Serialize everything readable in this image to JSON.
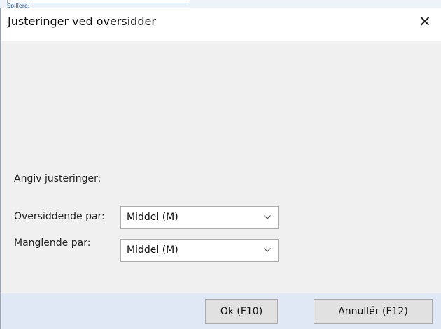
{
  "background": {
    "label": "Spillere:"
  },
  "dialog": {
    "title": "Justeringer ved oversidder",
    "close_glyph": "✕",
    "section_label": "Angiv justeringer:",
    "fields": [
      {
        "label": "Oversiddende par:",
        "value": "Middel (M)"
      },
      {
        "label": "Manglende par:",
        "value": "Middel (M)"
      }
    ],
    "buttons": {
      "ok": "Ok (F10)",
      "cancel": "Annullér (F12)"
    }
  },
  "colors": {
    "footer": "#dfe8f4",
    "titlebar": "#ffffff",
    "body": "#f0f0f0"
  }
}
